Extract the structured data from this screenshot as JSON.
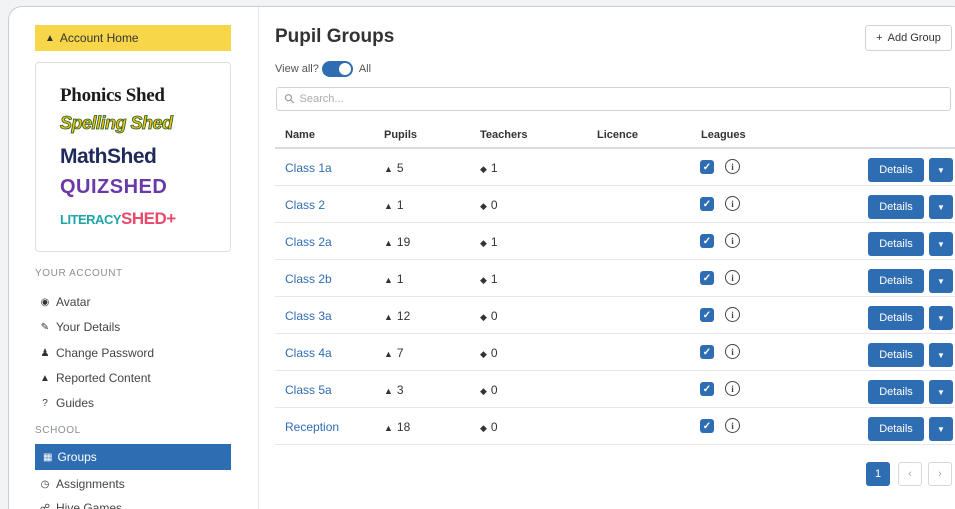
{
  "sidebar": {
    "home_label": "Account Home",
    "brands": {
      "phonics": "Phonics Shed",
      "spelling": "Spelling Shed",
      "math": "MathShed",
      "quiz": "QUIZSHED",
      "literacy_a": "LITERACY",
      "literacy_b": "SHED+"
    },
    "section_account": "YOUR ACCOUNT",
    "account_items": [
      {
        "label": "Avatar",
        "icon": "user-circle-icon"
      },
      {
        "label": "Your Details",
        "icon": "user-edit-icon"
      },
      {
        "label": "Change Password",
        "icon": "user-key-icon"
      },
      {
        "label": "Reported Content",
        "icon": "warning-icon"
      },
      {
        "label": "Guides",
        "icon": "question-icon"
      }
    ],
    "section_school": "SCHOOL",
    "school_items": [
      {
        "label": "Groups",
        "icon": "grid-icon",
        "active": true
      },
      {
        "label": "Assignments",
        "icon": "clock-icon"
      },
      {
        "label": "Hive Games",
        "icon": "network-icon"
      }
    ]
  },
  "main": {
    "title": "Pupil Groups",
    "add_button": "Add Group",
    "view_all_label": "View all?",
    "view_all_value": "All",
    "search_placeholder": "Search...",
    "columns": [
      "Name",
      "Pupils",
      "Teachers",
      "Licence",
      "Leagues"
    ],
    "rows": [
      {
        "name": "Class 1a",
        "pupils": "5",
        "teachers": "1"
      },
      {
        "name": "Class 2",
        "pupils": "1",
        "teachers": "0"
      },
      {
        "name": "Class 2a",
        "pupils": "19",
        "teachers": "1"
      },
      {
        "name": "Class 2b",
        "pupils": "1",
        "teachers": "1"
      },
      {
        "name": "Class 3a",
        "pupils": "12",
        "teachers": "0"
      },
      {
        "name": "Class 4a",
        "pupils": "7",
        "teachers": "0"
      },
      {
        "name": "Class 5a",
        "pupils": "3",
        "teachers": "0"
      },
      {
        "name": "Reception",
        "pupils": "18",
        "teachers": "0"
      }
    ],
    "details_label": "Details",
    "pagination": {
      "current": "1",
      "prev": "‹",
      "next": "›"
    },
    "accent_color": "#2f6db3"
  }
}
